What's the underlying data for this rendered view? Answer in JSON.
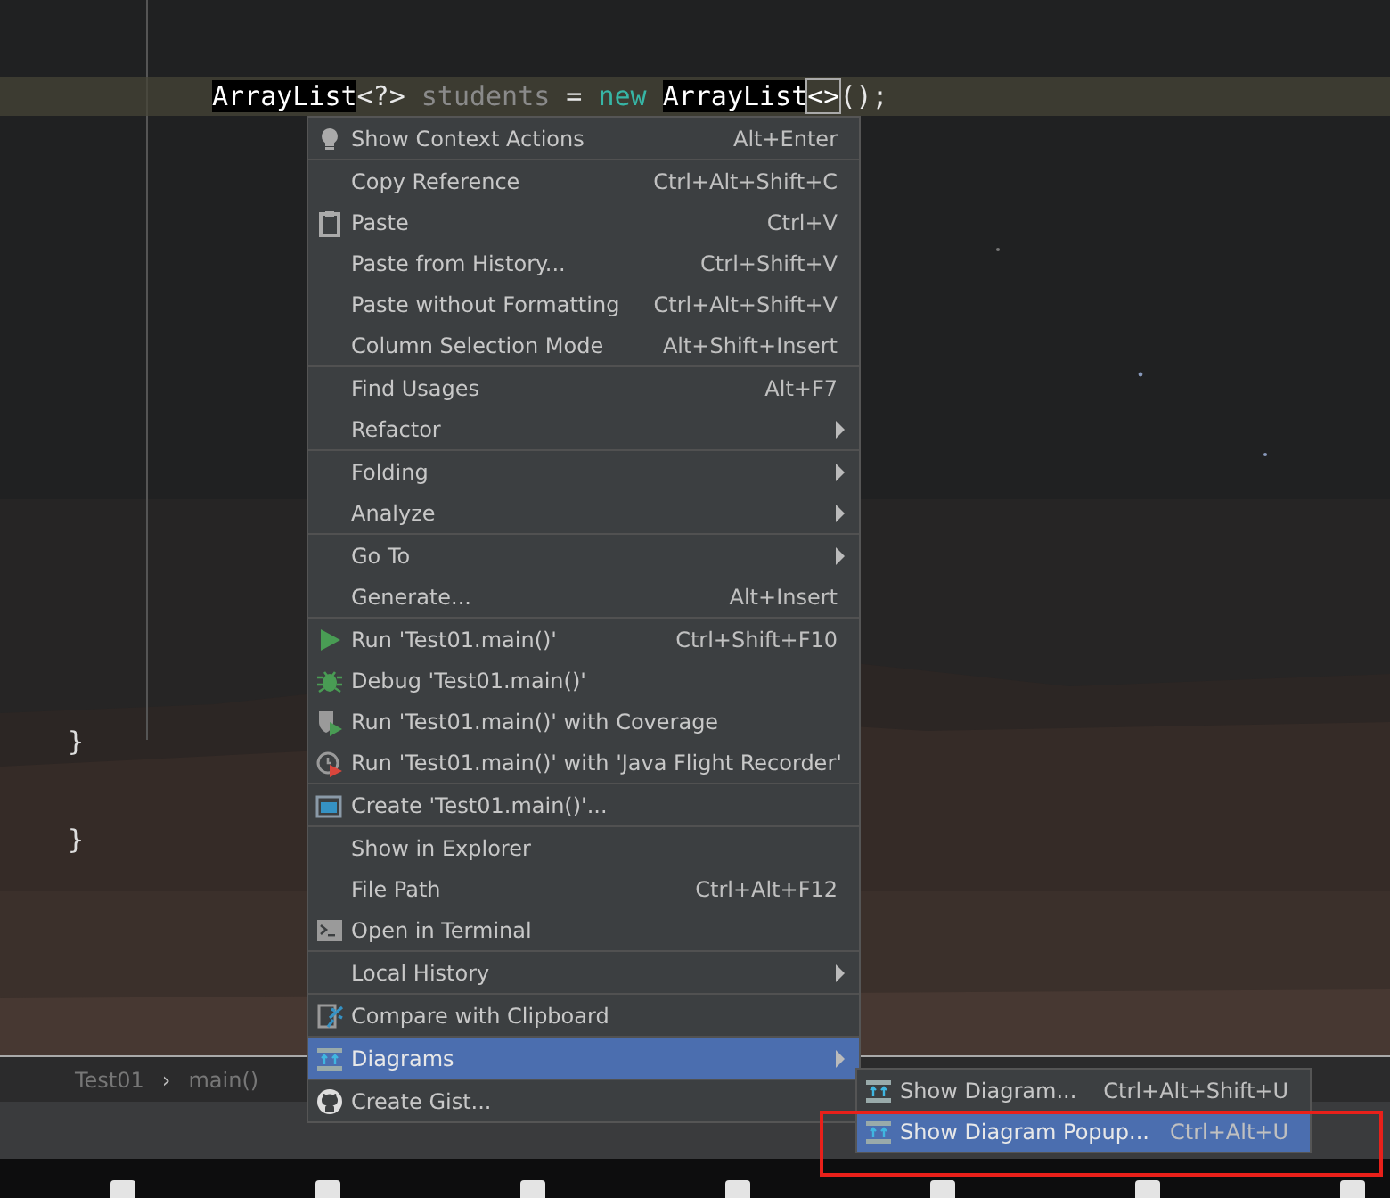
{
  "editor": {
    "code_lines": [
      {
        "tokens": [
          {
            "text": "ArrayList",
            "kind": "highlight"
          },
          {
            "text": "<?>",
            "kind": "plain"
          },
          {
            "text": " students",
            "kind": "unused"
          },
          {
            "text": " = ",
            "kind": "plain"
          },
          {
            "text": "new",
            "kind": "keyword"
          },
          {
            "text": "ArrayList",
            "kind": "highlight"
          },
          {
            "text": "<>",
            "kind": "boxed"
          },
          {
            "text": "();",
            "kind": "plain"
          }
        ]
      }
    ],
    "closing_braces": [
      "}",
      "}"
    ]
  },
  "breadcrumbs": [
    {
      "label": "Test01"
    },
    {
      "separator": "›"
    },
    {
      "label": "main()"
    }
  ],
  "context_menu": {
    "groups": [
      [
        {
          "kind": "bulb",
          "label": "Show Context Actions",
          "shortcut": "Alt+Enter",
          "submenu": false,
          "selected": false
        }
      ],
      [
        {
          "kind": "plain",
          "label": "Copy Reference",
          "shortcut": "Ctrl+Alt+Shift+C",
          "submenu": false,
          "selected": false
        },
        {
          "kind": "clipboard",
          "label": "Paste",
          "shortcut": "Ctrl+V",
          "submenu": false,
          "selected": false
        },
        {
          "kind": "plain",
          "label": "Paste from History...",
          "shortcut": "Ctrl+Shift+V",
          "submenu": false,
          "selected": false
        },
        {
          "kind": "plain",
          "label": "Paste without Formatting",
          "shortcut": "Ctrl+Alt+Shift+V",
          "submenu": false,
          "selected": false
        },
        {
          "kind": "plain",
          "label": "Column Selection Mode",
          "shortcut": "Alt+Shift+Insert",
          "submenu": false,
          "selected": false
        }
      ],
      [
        {
          "kind": "plain",
          "label": "Find Usages",
          "shortcut": "Alt+F7",
          "submenu": false,
          "selected": false
        },
        {
          "kind": "plain",
          "label": "Refactor",
          "submenu": true,
          "selected": false
        }
      ],
      [
        {
          "kind": "plain",
          "label": "Folding",
          "submenu": true,
          "selected": false
        },
        {
          "kind": "plain",
          "label": "Analyze",
          "submenu": true,
          "selected": false
        }
      ],
      [
        {
          "kind": "plain",
          "label": "Go To",
          "submenu": true,
          "selected": false
        },
        {
          "kind": "plain",
          "label": "Generate...",
          "shortcut": "Alt+Insert",
          "submenu": false,
          "selected": false
        }
      ],
      [
        {
          "kind": "run",
          "label": "Run 'Test01.main()'",
          "shortcut": "Ctrl+Shift+F10",
          "submenu": false,
          "selected": false
        },
        {
          "kind": "debug",
          "label": "Debug 'Test01.main()'",
          "submenu": false,
          "selected": false
        },
        {
          "kind": "coverage",
          "label": "Run 'Test01.main()' with Coverage",
          "submenu": false,
          "selected": false
        },
        {
          "kind": "recorder",
          "label": "Run 'Test01.main()' with 'Java Flight Recorder'",
          "submenu": false,
          "selected": false
        }
      ],
      [
        {
          "kind": "window",
          "label": "Create 'Test01.main()'...",
          "submenu": false,
          "selected": false
        }
      ],
      [
        {
          "kind": "plain",
          "label": "Show in Explorer",
          "submenu": false,
          "selected": false
        },
        {
          "kind": "plain",
          "label": "File Path",
          "shortcut": "Ctrl+Alt+F12",
          "submenu": false,
          "selected": false
        },
        {
          "kind": "terminal",
          "label": "Open in Terminal",
          "submenu": false,
          "selected": false
        }
      ],
      [
        {
          "kind": "plain",
          "label": "Local History",
          "submenu": true,
          "selected": false
        }
      ],
      [
        {
          "kind": "compare",
          "label": "Compare with Clipboard",
          "submenu": false,
          "selected": false
        }
      ],
      [
        {
          "kind": "diagram",
          "label": "Diagrams",
          "submenu": true,
          "selected": true
        }
      ],
      [
        {
          "kind": "gist",
          "label": "Create Gist...",
          "submenu": false,
          "selected": false
        }
      ]
    ]
  },
  "submenu": {
    "items": [
      {
        "kind": "diagram",
        "label": "Show Diagram...",
        "shortcut": "Ctrl+Alt+Shift+U",
        "selected": false
      },
      {
        "kind": "diagram",
        "label": "Show Diagram Popup...",
        "shortcut": "Ctrl+Alt+U",
        "selected": true
      }
    ]
  }
}
